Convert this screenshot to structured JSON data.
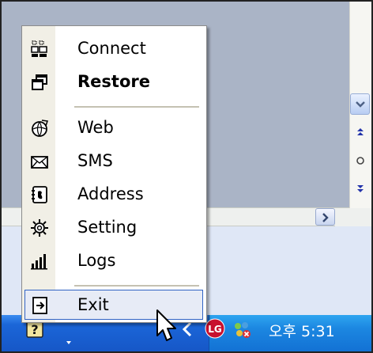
{
  "menu": {
    "items": [
      {
        "label": "Connect",
        "icon": "connect-icon",
        "bold": false
      },
      {
        "label": "Restore",
        "icon": "restore-window-icon",
        "bold": true
      },
      {
        "label": "Web",
        "icon": "globe-icon",
        "bold": false
      },
      {
        "label": "SMS",
        "icon": "envelope-icon",
        "bold": false
      },
      {
        "label": "Address",
        "icon": "address-book-icon",
        "bold": false
      },
      {
        "label": "Setting",
        "icon": "gear-icon",
        "bold": false
      },
      {
        "label": "Logs",
        "icon": "bar-chart-icon",
        "bold": false
      },
      {
        "label": "Exit",
        "icon": "exit-door-icon",
        "bold": false,
        "highlighted": true
      }
    ]
  },
  "taskbar": {
    "clock": "오후 5:31",
    "tray_icons": [
      "help-icon",
      "chevron-down-icon",
      "tray-app-icon",
      "lg-logo-icon",
      "network-icon"
    ]
  },
  "colors": {
    "taskbar": "#1656c6",
    "tray": "#1c87e1",
    "menu_highlight": "#e7ebf6",
    "menu_highlight_border": "#3163c4",
    "background_window": "#aab4c6"
  }
}
